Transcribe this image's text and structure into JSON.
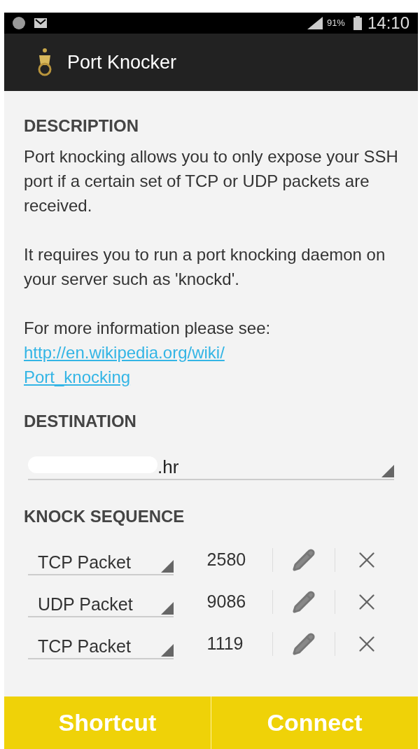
{
  "status_bar": {
    "battery_text": "91%",
    "time": "14:10"
  },
  "app_bar": {
    "title": "Port Knocker"
  },
  "description": {
    "heading": "DESCRIPTION",
    "paragraphs": [
      "Port knocking allows you to only expose your SSH port if a certain set of TCP or UDP packets are received.",
      "It requires you to run a port knocking daemon on your server such as 'knockd'.",
      "For more information please see:"
    ],
    "link": "http://en.wikipedia.org/wiki/Port_knocking"
  },
  "destination": {
    "heading": "DESTINATION",
    "value": ".hr"
  },
  "knock_sequence": {
    "heading": "KNOCK SEQUENCE",
    "rows": [
      {
        "protocol": "TCP Packet",
        "port": "2580"
      },
      {
        "protocol": "UDP Packet",
        "port": "9086"
      },
      {
        "protocol": "TCP Packet",
        "port": "1119"
      }
    ]
  },
  "buttons": [
    "Shortcut",
    "Connect"
  ]
}
